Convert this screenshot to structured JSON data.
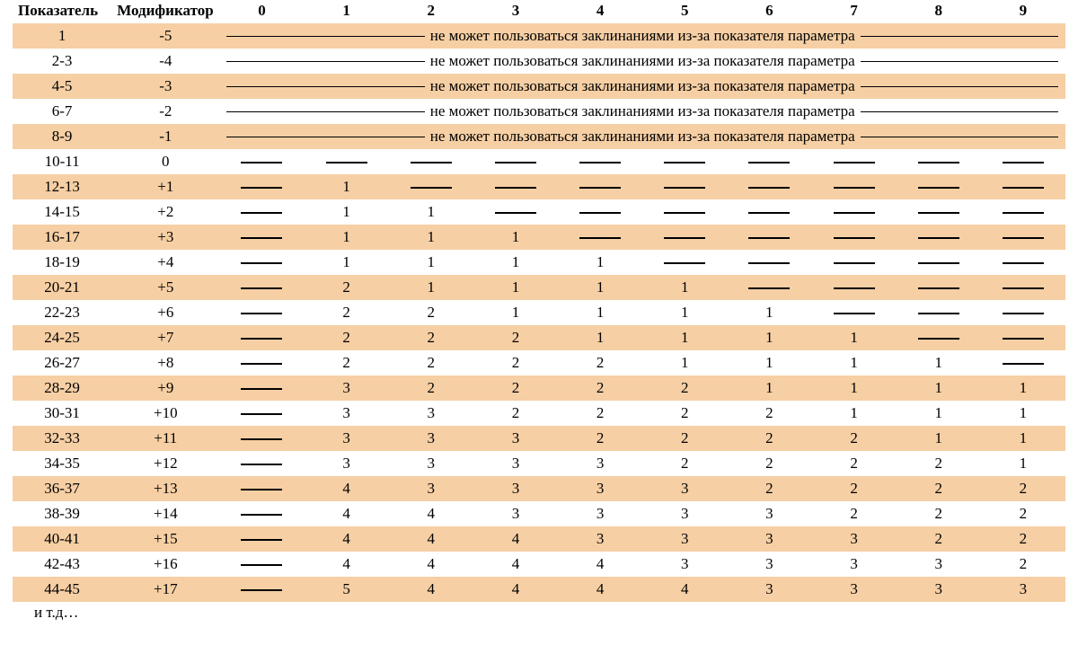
{
  "chart_data": {
    "type": "table",
    "title": "",
    "columns": [
      "Показатель",
      "Модификатор",
      "0",
      "1",
      "2",
      "3",
      "4",
      "5",
      "6",
      "7",
      "8",
      "9"
    ],
    "cannot_cast_text": "не   может пользоваться заклинаниями из-за показателя параметра",
    "rows": [
      {
        "stat": "1",
        "mod": "-5",
        "spells": "banner"
      },
      {
        "stat": "2-3",
        "mod": "-4",
        "spells": "banner"
      },
      {
        "stat": "4-5",
        "mod": "-3",
        "spells": "banner"
      },
      {
        "stat": "6-7",
        "mod": "-2",
        "spells": "banner"
      },
      {
        "stat": "8-9",
        "mod": "-1",
        "spells": "banner"
      },
      {
        "stat": "10-11",
        "mod": "0",
        "spells": [
          "—",
          "—",
          "—",
          "—",
          "—",
          "—",
          "—",
          "—",
          "—",
          "—"
        ]
      },
      {
        "stat": "12-13",
        "mod": "+1",
        "spells": [
          "—",
          "1",
          "—",
          "—",
          "—",
          "—",
          "—",
          "—",
          "—",
          "—"
        ]
      },
      {
        "stat": "14-15",
        "mod": "+2",
        "spells": [
          "—",
          "1",
          "1",
          "—",
          "—",
          "—",
          "—",
          "—",
          "—",
          "—"
        ]
      },
      {
        "stat": "16-17",
        "mod": "+3",
        "spells": [
          "—",
          "1",
          "1",
          "1",
          "—",
          "—",
          "—",
          "—",
          "—",
          "—"
        ]
      },
      {
        "stat": "18-19",
        "mod": "+4",
        "spells": [
          "—",
          "1",
          "1",
          "1",
          "1",
          "—",
          "—",
          "—",
          "—",
          "—"
        ]
      },
      {
        "stat": "20-21",
        "mod": "+5",
        "spells": [
          "—",
          "2",
          "1",
          "1",
          "1",
          "1",
          "—",
          "—",
          "—",
          "—"
        ]
      },
      {
        "stat": "22-23",
        "mod": "+6",
        "spells": [
          "—",
          "2",
          "2",
          "1",
          "1",
          "1",
          "1",
          "—",
          "—",
          "—"
        ]
      },
      {
        "stat": "24-25",
        "mod": "+7",
        "spells": [
          "—",
          "2",
          "2",
          "2",
          "1",
          "1",
          "1",
          "1",
          "—",
          "—"
        ]
      },
      {
        "stat": "26-27",
        "mod": "+8",
        "spells": [
          "—",
          "2",
          "2",
          "2",
          "2",
          "1",
          "1",
          "1",
          "1",
          "—"
        ]
      },
      {
        "stat": "28-29",
        "mod": "+9",
        "spells": [
          "—",
          "3",
          "2",
          "2",
          "2",
          "2",
          "1",
          "1",
          "1",
          "1"
        ]
      },
      {
        "stat": "30-31",
        "mod": "+10",
        "spells": [
          "—",
          "3",
          "3",
          "2",
          "2",
          "2",
          "2",
          "1",
          "1",
          "1"
        ]
      },
      {
        "stat": "32-33",
        "mod": "+11",
        "spells": [
          "—",
          "3",
          "3",
          "3",
          "2",
          "2",
          "2",
          "2",
          "1",
          "1"
        ]
      },
      {
        "stat": "34-35",
        "mod": "+12",
        "spells": [
          "—",
          "3",
          "3",
          "3",
          "3",
          "2",
          "2",
          "2",
          "2",
          "1"
        ]
      },
      {
        "stat": "36-37",
        "mod": "+13",
        "spells": [
          "—",
          "4",
          "3",
          "3",
          "3",
          "3",
          "2",
          "2",
          "2",
          "2"
        ]
      },
      {
        "stat": "38-39",
        "mod": "+14",
        "spells": [
          "—",
          "4",
          "4",
          "3",
          "3",
          "3",
          "3",
          "2",
          "2",
          "2"
        ]
      },
      {
        "stat": "40-41",
        "mod": "+15",
        "spells": [
          "—",
          "4",
          "4",
          "4",
          "3",
          "3",
          "3",
          "3",
          "2",
          "2"
        ]
      },
      {
        "stat": "42-43",
        "mod": "+16",
        "spells": [
          "—",
          "4",
          "4",
          "4",
          "4",
          "3",
          "3",
          "3",
          "3",
          "2"
        ]
      },
      {
        "stat": "44-45",
        "mod": "+17",
        "spells": [
          "—",
          "5",
          "4",
          "4",
          "4",
          "4",
          "3",
          "3",
          "3",
          "3"
        ]
      }
    ],
    "footnote": "и т.д…"
  }
}
